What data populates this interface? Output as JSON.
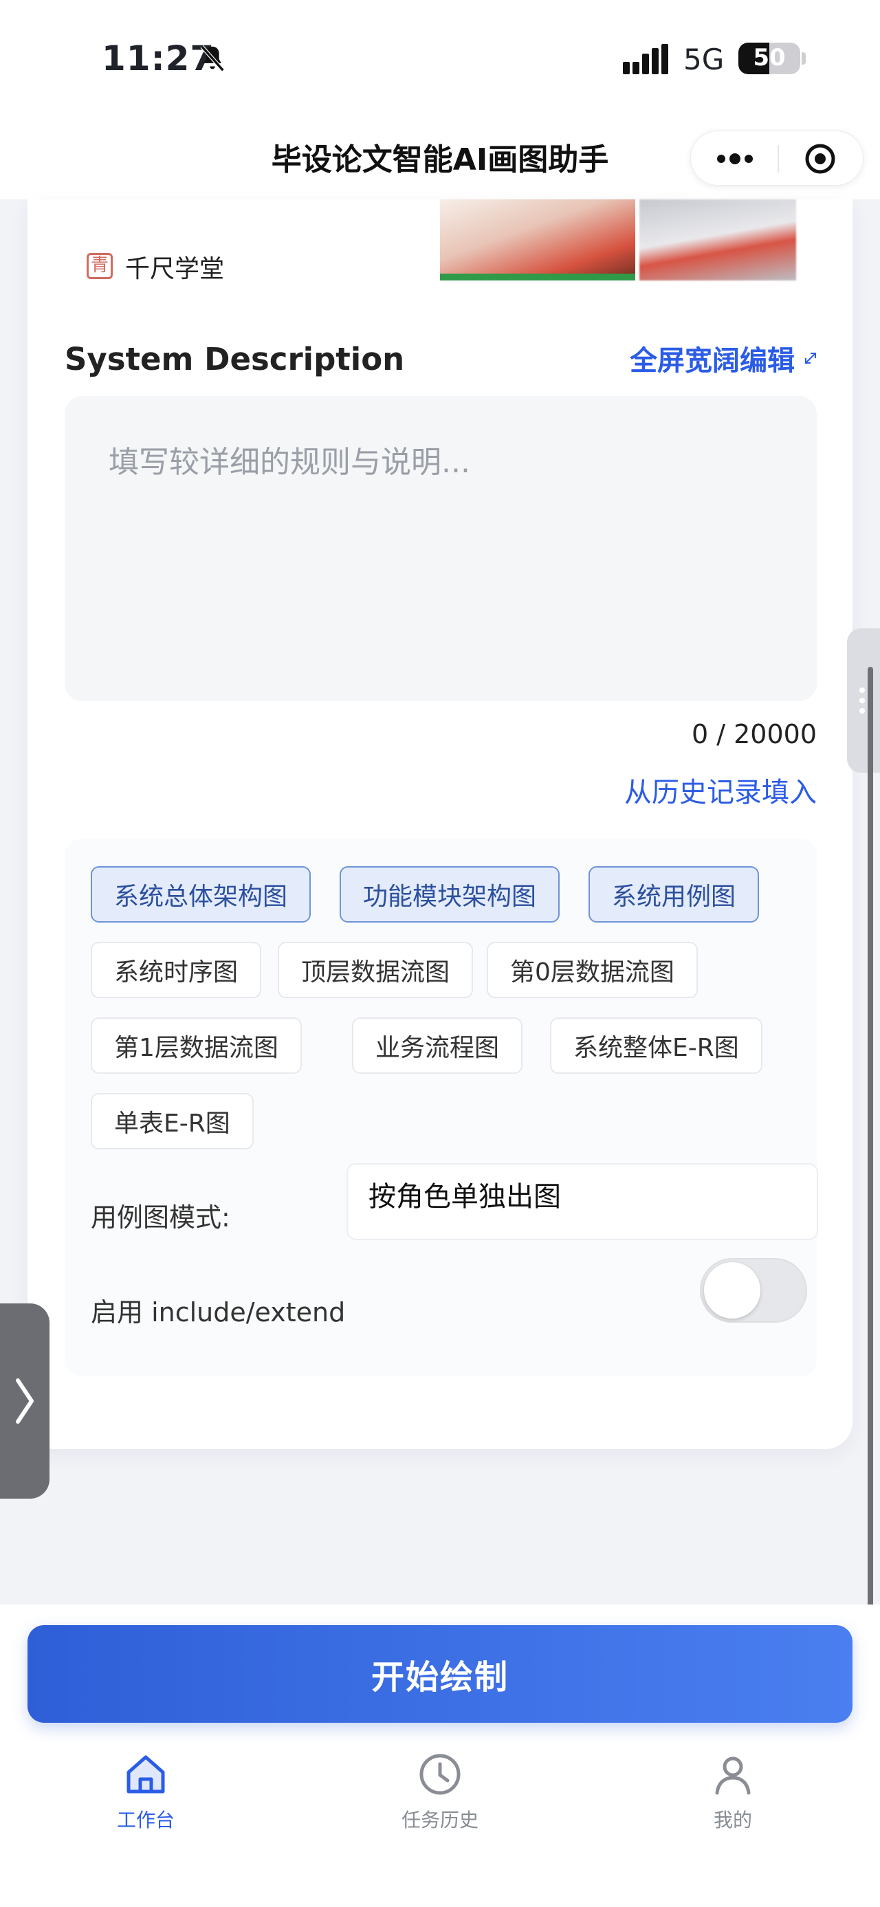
{
  "status_bar": {
    "time": "11:27",
    "network": "5G",
    "battery": "50",
    "battery_level": 0.5
  },
  "nav": {
    "title": "毕设论文智能AI画图助手"
  },
  "source": {
    "name": "千尺学堂",
    "logo_char": "青"
  },
  "description": {
    "title": "System Description",
    "fullscreen_label": "全屏宽阔编辑",
    "placeholder": "填写较详细的规则与说明...",
    "value": "",
    "counter": "0 / 20000",
    "history_label": "从历史记录填入"
  },
  "diagram_types": [
    {
      "label": "系统总体架构图",
      "selected": true
    },
    {
      "label": "功能模块架构图",
      "selected": true
    },
    {
      "label": "系统用例图",
      "selected": true
    },
    {
      "label": "系统时序图",
      "selected": false
    },
    {
      "label": "顶层数据流图",
      "selected": false
    },
    {
      "label": "第0层数据流图",
      "selected": false
    },
    {
      "label": "第1层数据流图",
      "selected": false
    },
    {
      "label": "业务流程图",
      "selected": false
    },
    {
      "label": "系统整体E-R图",
      "selected": false
    },
    {
      "label": "单表E-R图",
      "selected": false
    }
  ],
  "use_case_mode": {
    "label": "用例图模式:",
    "value": "按角色单独出图"
  },
  "include_extend": {
    "label": "启用 include/extend",
    "enabled": false
  },
  "start_button": {
    "label": "开始绘制"
  },
  "tabbar": [
    {
      "label": "工作台",
      "icon": "home-icon",
      "active": true
    },
    {
      "label": "任务历史",
      "icon": "clock-icon",
      "active": false
    },
    {
      "label": "我的",
      "icon": "user-icon",
      "active": false
    }
  ],
  "colors": {
    "accent": "#2b5ce6",
    "chip_selected_bg": "#e4ecfb"
  }
}
